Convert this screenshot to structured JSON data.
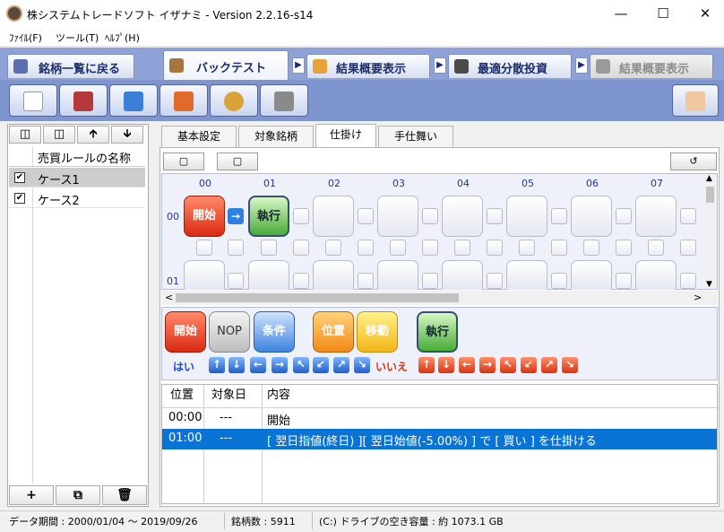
{
  "window": {
    "title": "株システムトレードソフト イザナミ - Version 2.2.16-s14"
  },
  "menu": [
    "ﾌｧｲﾙ(F)",
    "ツール(T)",
    "ﾍﾙﾌﾟ(H)"
  ],
  "nav_tabs": [
    {
      "label": "銘柄一覧に戻る",
      "icon": "eye-icon"
    },
    {
      "label": "バックテスト",
      "icon": "bag-icon"
    },
    {
      "label": "結果概要表示",
      "icon": "chart-icon"
    },
    {
      "label": "最適分散投資",
      "icon": "calculator-icon"
    },
    {
      "label": "結果概要表示",
      "icon": "chart-icon"
    }
  ],
  "toolbar": [
    "new-file-icon",
    "export-icon",
    "import-icon",
    "edit-icon",
    "palette-icon",
    "tools-icon",
    "help-hand-icon"
  ],
  "left_panel": {
    "header": "売買ルールの名称",
    "rules": [
      {
        "label": "ケース1",
        "checked": true
      },
      {
        "label": "ケース2",
        "checked": true
      }
    ],
    "checkmark": "✔"
  },
  "sub_tabs": [
    "基本設定",
    "対象銘柄",
    "仕掛け",
    "手仕舞い"
  ],
  "grid": {
    "columns": [
      "00",
      "01",
      "02",
      "03",
      "04",
      "05",
      "06",
      "07"
    ],
    "rows": [
      "00",
      "01"
    ],
    "blocks": {
      "start": "開始",
      "execute": "執行"
    }
  },
  "palette": {
    "blocks": [
      "開始",
      "NOP",
      "条件",
      "位置",
      "移動",
      "執行"
    ],
    "yes": "はい",
    "no": "いいえ"
  },
  "table": {
    "headers": [
      "位置",
      "対象日",
      "内容"
    ],
    "rows": [
      {
        "pos": "00:00",
        "date": "---",
        "content": "開始"
      },
      {
        "pos": "01:00",
        "date": "---",
        "content": "[ 翌日指値(終日) ][ 翌日始値(-5.00%) ] で [ 買い ] を仕掛ける"
      }
    ]
  },
  "status": {
    "period": "データ期間 : 2000/01/04 〜 2019/09/26",
    "stocks": "銘柄数 : 5911",
    "disk": "(C:) ドライブの空き容量 : 約 1073.1 GB"
  }
}
